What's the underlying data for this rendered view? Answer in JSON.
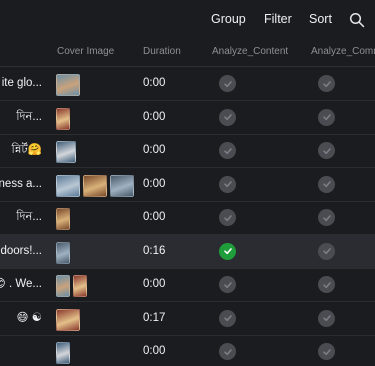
{
  "toolbar": {
    "group_label": "Group",
    "filter_label": "Filter",
    "sort_label": "Sort",
    "search_icon": "search-icon"
  },
  "columns": {
    "cover_image": "Cover Image",
    "duration": "Duration",
    "analyze_content": "Analyze_Content",
    "analyze_comments": "Analyze_Comm"
  },
  "rows": [
    {
      "title": "ite glo...",
      "duration": "0:00",
      "analyze_content": false,
      "analyze_comments": false,
      "thumbs": [
        "wide"
      ]
    },
    {
      "title": "দিন...",
      "duration": "0:00",
      "analyze_content": false,
      "analyze_comments": false,
      "thumbs": [
        "narrow"
      ]
    },
    {
      "title": "ন্নির্ট🤗",
      "duration": "0:00",
      "analyze_content": false,
      "analyze_comments": false,
      "thumbs": [
        "mid"
      ]
    },
    {
      "title": "ness a...",
      "duration": "0:00",
      "analyze_content": false,
      "analyze_comments": false,
      "thumbs": [
        "wide",
        "wide",
        "wide"
      ]
    },
    {
      "title": "দিন...",
      "duration": "0:00",
      "analyze_content": false,
      "analyze_comments": false,
      "thumbs": [
        "narrow"
      ]
    },
    {
      "title": "doors!...",
      "duration": "0:16",
      "analyze_content": true,
      "analyze_comments": false,
      "thumbs": [
        "narrow"
      ],
      "selected": true
    },
    {
      "title": "😊 . We...",
      "duration": "0:00",
      "analyze_content": false,
      "analyze_comments": false,
      "thumbs": [
        "narrow",
        "narrow"
      ]
    },
    {
      "title": "😄 ☯",
      "duration": "0:17",
      "analyze_content": false,
      "analyze_comments": false,
      "thumbs": [
        "wide"
      ]
    },
    {
      "title": "",
      "duration": "0:00",
      "analyze_content": false,
      "analyze_comments": false,
      "thumbs": [
        "narrow"
      ]
    }
  ],
  "colors": {
    "background": "#1b1c1f",
    "check_off": "#4a4c52",
    "check_on": "#1f9d3a"
  }
}
